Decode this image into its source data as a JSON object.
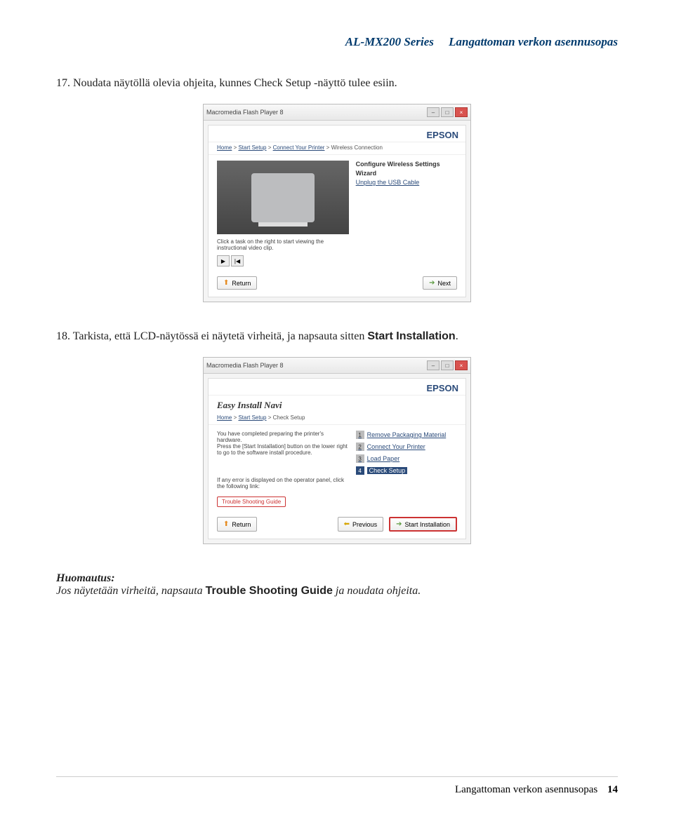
{
  "header": {
    "series": "AL-MX200 Series",
    "guide": "Langattoman verkon asennusopas"
  },
  "step17": {
    "text": "17. Noudata näytöllä olevia ohjeita, kunnes Check Setup -näyttö tulee esiin."
  },
  "screenshot1": {
    "titlebar": "Macromedia Flash Player 8",
    "brand": "EPSON",
    "breadcrumb": {
      "home": "Home",
      "s1": "Start Setup",
      "s2": "Connect Your Printer",
      "s3": "Wireless Connection"
    },
    "caption": "Click a task on the right to start viewing the instructional video clip.",
    "right": {
      "heading1": "Configure Wireless Settings",
      "heading2": "Wizard",
      "link": "Unplug the USB Cable"
    },
    "buttons": {
      "return": "Return",
      "next": "Next"
    }
  },
  "step18": {
    "prefix": "18. Tarkista, että LCD-näytössä ei näytetä virheitä, ja napsauta sitten ",
    "bold": "Start Installation",
    "suffix": "."
  },
  "screenshot2": {
    "titlebar": "Macromedia Flash Player 8",
    "brand": "EPSON",
    "navi": "Easy Install Navi",
    "breadcrumb": {
      "home": "Home",
      "s1": "Start Setup",
      "s2": "Check Setup"
    },
    "info1": "You have completed preparing the printer's hardware.\nPress the [Start Installation] button on the lower right to go to the software install procedure.",
    "info2": "If any error is displayed on the operator panel, click the following link:",
    "tsg": "Trouble Shooting Guide",
    "steps": [
      {
        "n": "1",
        "label": "Remove Packaging Material"
      },
      {
        "n": "2",
        "label": "Connect Your Printer"
      },
      {
        "n": "3",
        "label": "Load Paper"
      },
      {
        "n": "4",
        "label": "Check Setup",
        "active": true
      }
    ],
    "buttons": {
      "return": "Return",
      "previous": "Previous",
      "start": "Start Installation"
    }
  },
  "note": {
    "head": "Huomautus:",
    "body_prefix": "Jos näytetään virheitä, napsauta ",
    "body_bold": "Trouble Shooting Guide",
    "body_suffix": " ja noudata ohjeita."
  },
  "footer": {
    "text": "Langattoman verkon asennusopas",
    "page": "14"
  }
}
